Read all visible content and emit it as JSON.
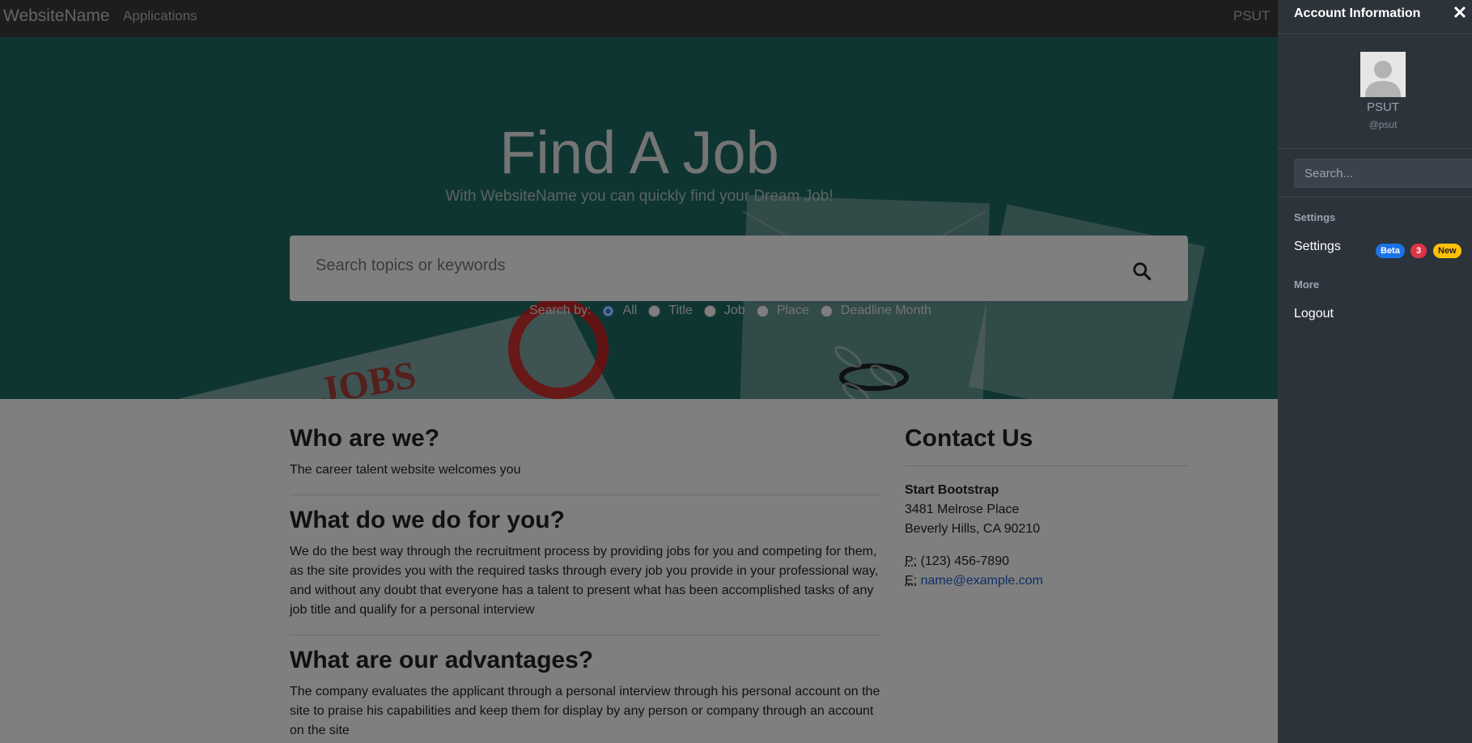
{
  "navbar": {
    "brand": "WebsiteName",
    "link_applications": "Applications",
    "user": "PSUT"
  },
  "hero": {
    "title": "Find A Job",
    "subtitle": "With WebsiteName you can quickly find your Dream Job!",
    "search_placeholder": "Search topics or keywords",
    "search_by_label": "Search by:",
    "options": [
      "All",
      "Title",
      "Job",
      "Place",
      "Deadline Month"
    ],
    "selected_option": "All"
  },
  "about": {
    "who_title": "Who are we?",
    "who_text": "The career talent website welcomes you",
    "what_title": "What do we do for you?",
    "what_text": "We do the best way through the recruitment process by providing jobs for you and competing for them, as the site provides you with the required tasks through every job you provide in your professional way, and without any doubt that everyone has a talent to present what has been accomplished tasks of any job title and qualify for a personal interview",
    "adv_title": "What are our advantages?",
    "adv_text": "The company evaluates the applicant through a personal interview through his personal account on the site to praise his capabilities and keep them for display by any person or company through an account on the site"
  },
  "contact": {
    "title": "Contact Us",
    "company": "Start Bootstrap",
    "address1": "3481 Melrose Place",
    "address2": "Beverly Hills, CA 90210",
    "phone_label": "P:",
    "phone": "(123) 456-7890",
    "email_label": "E:",
    "email": "name@example.com"
  },
  "sidebar": {
    "title": "Account Information",
    "user_name": "PSUT",
    "user_handle": "@psut",
    "search_placeholder": "Search...",
    "section_settings": "Settings",
    "item_settings": "Settings",
    "badge_beta": "Beta",
    "badge_count": "3",
    "badge_new": "New",
    "section_more": "More",
    "item_logout": "Logout"
  },
  "colors": {
    "hero_bg": "#1c6b64",
    "sidebar_bg": "#2d333b",
    "navbar_bg": "#3a3a3a",
    "link": "#1a5fcc",
    "badge_beta": "#1a73e8",
    "badge_count": "#dc3545",
    "badge_new": "#ffc107"
  }
}
